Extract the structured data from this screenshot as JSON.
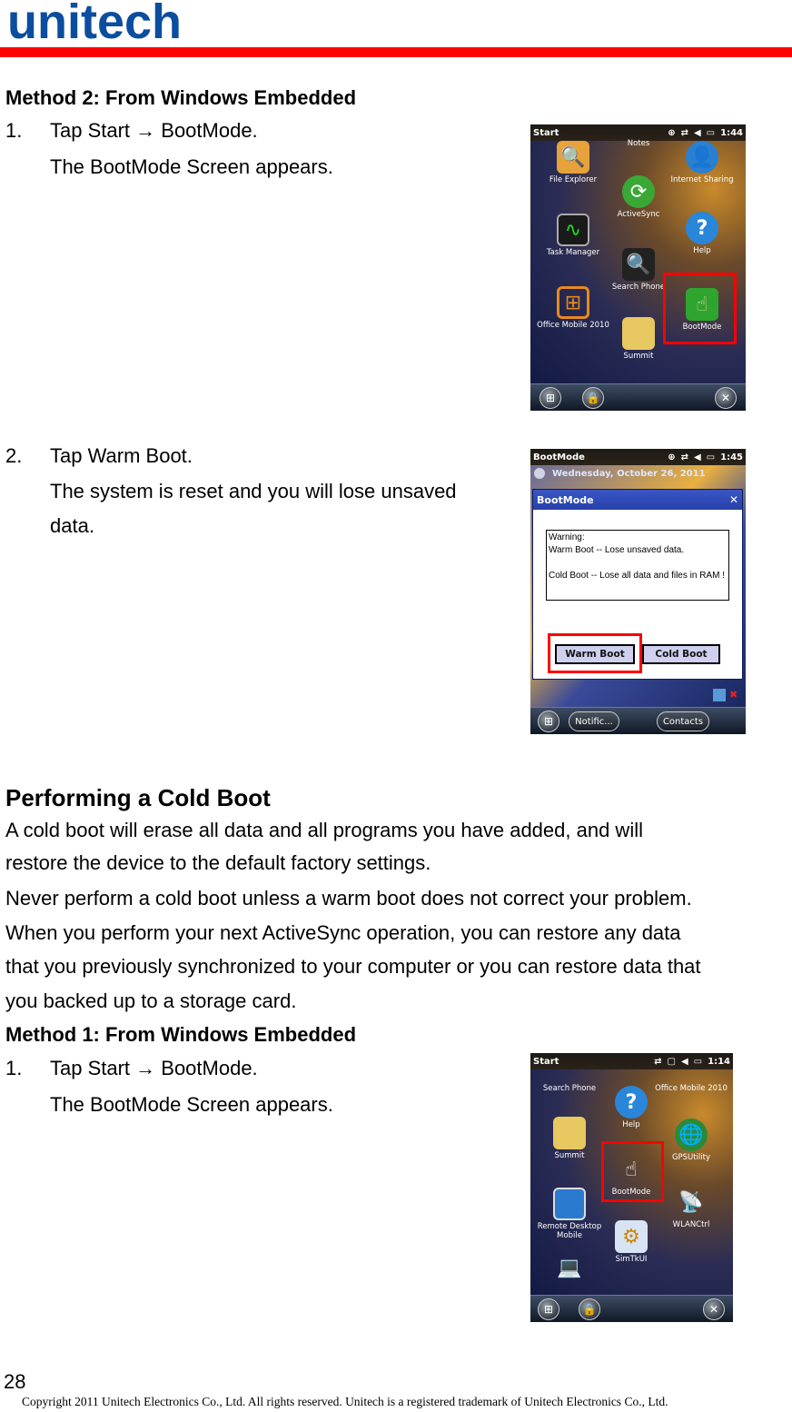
{
  "header": {
    "logo_text": "unitech",
    "brand_color": "#0b4d9e",
    "rule_color": "#ff0000"
  },
  "method2": {
    "heading": "Method 2: From Windows Embedded",
    "step1": {
      "number": "1.",
      "text": "Tap Start → BootMode.",
      "result": "The BootMode Screen appears."
    },
    "step2": {
      "number": "2.",
      "text": "Tap Warm Boot.",
      "result_line1": "The system is reset and you will lose unsaved",
      "result_line2": "data."
    }
  },
  "shot1": {
    "status_title": "Start",
    "status_icons": [
      "notification-icon",
      "sync-icon",
      "volume-icon",
      "battery-icon"
    ],
    "time": "1:44",
    "apps": [
      {
        "label": "File Explorer",
        "icon": "folder-search-icon"
      },
      {
        "label": "Notes",
        "icon": "notes-icon"
      },
      {
        "label": "Internet Sharing",
        "icon": "internet-sharing-icon"
      },
      {
        "label": "ActiveSync",
        "icon": "activesync-icon"
      },
      {
        "label": "Task Manager",
        "icon": "task-manager-icon"
      },
      {
        "label": "Help",
        "icon": "help-icon"
      },
      {
        "label": "Search Phone",
        "icon": "search-phone-icon"
      },
      {
        "label": "Office Mobile 2010",
        "icon": "office-icon"
      },
      {
        "label": "BootMode",
        "icon": "bootmode-icon"
      },
      {
        "label": "Summit",
        "icon": "folder-icon"
      }
    ],
    "highlighted": "BootMode"
  },
  "shot2": {
    "status_title": "BootMode",
    "time": "1:45",
    "date": "Wednesday, October 26, 2011",
    "dialog_title": "BootMode",
    "close": "✕",
    "warning_text": "Warning:\nWarm Boot -- Lose unsaved data.\n\nCold Boot -- Lose all data and files in RAM !",
    "warm_boot": "Warm Boot",
    "cold_boot": "Cold Boot",
    "highlighted": "Warm Boot",
    "softkey_left": "Notific...",
    "softkey_right": "Contacts"
  },
  "cold_boot": {
    "heading": "Performing a Cold Boot",
    "para1_line1": "A cold boot will erase all data and all programs you have added, and will",
    "para1_line2": "restore the device to the default factory settings.",
    "para2": "Never perform a cold boot unless a warm boot does not correct your problem.",
    "para3_line1": "When you perform your next ActiveSync operation, you can restore any data",
    "para3_line2": "that you previously synchronized to your computer or you can restore data that",
    "para3_line3": "you backed up to a storage card.",
    "method1_heading": "Method 1: From Windows Embedded",
    "step1": {
      "number": "1.",
      "text": "Tap Start → BootMode.",
      "result": "The BootMode Screen appears."
    }
  },
  "shot3": {
    "status_title": "Start",
    "time": "1:14",
    "apps": [
      {
        "label": "Search Phone",
        "icon": "search-phone-icon"
      },
      {
        "label": "Office Mobile 2010",
        "icon": "office-icon"
      },
      {
        "label": "Help",
        "icon": "help-icon"
      },
      {
        "label": "Summit",
        "icon": "folder-icon"
      },
      {
        "label": "GPSUtility",
        "icon": "globe-icon"
      },
      {
        "label": "BootMode",
        "icon": "bootmode-icon"
      },
      {
        "label": "Remote Desktop Mobile",
        "icon": "remote-desktop-icon"
      },
      {
        "label": "WLANCtrl",
        "icon": "satellite-dish-icon"
      },
      {
        "label": "SimTkUI",
        "icon": "sim-toolkit-icon"
      }
    ],
    "highlighted": "BootMode"
  },
  "footer": {
    "page_number": "28",
    "copyright": "Copyright 2011 Unitech Electronics Co., Ltd. All rights reserved. Unitech is a registered trademark of Unitech Electronics Co., Ltd."
  }
}
